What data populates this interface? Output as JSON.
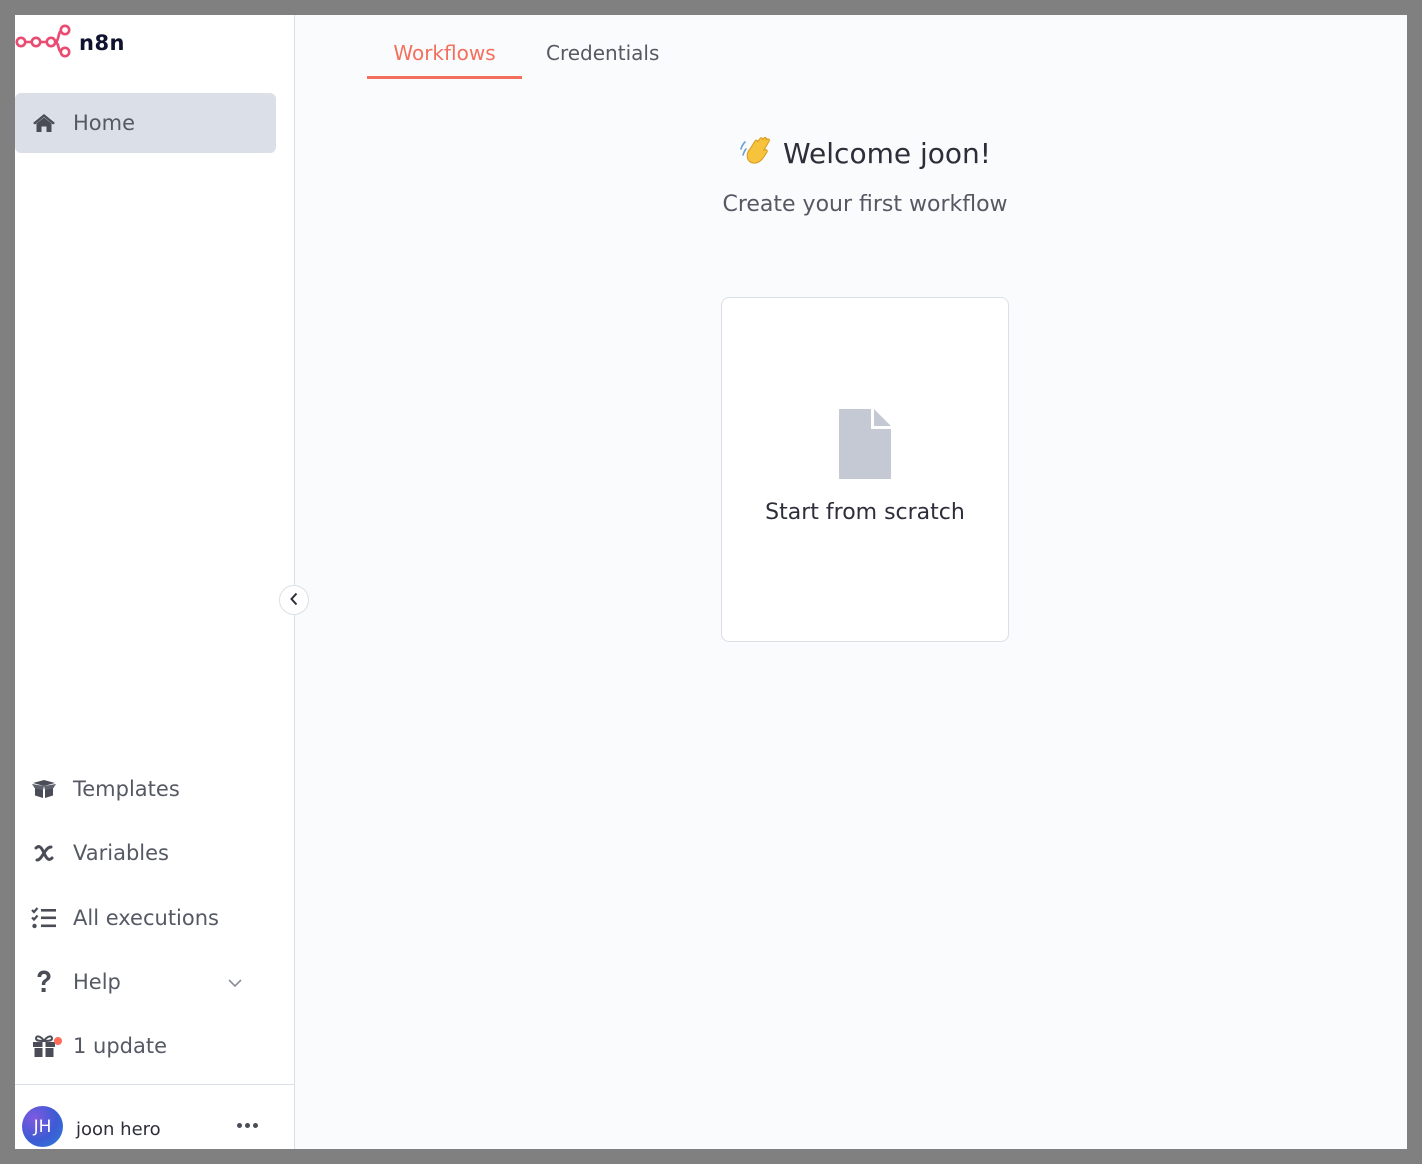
{
  "brand": {
    "name": "n8n",
    "accent": "#ea4b71"
  },
  "sidebar": {
    "home": {
      "label": "Home",
      "icon": "home-icon"
    },
    "bottom_items": [
      {
        "label": "Templates",
        "icon": "box-open-icon"
      },
      {
        "label": "Variables",
        "icon": "variable-x-icon"
      },
      {
        "label": "All executions",
        "icon": "tasks-list-icon"
      },
      {
        "label": "Help",
        "icon": "question-icon"
      },
      {
        "label": "1 update",
        "icon": "gift-icon"
      }
    ],
    "user": {
      "initials": "JH",
      "name": "joon hero"
    }
  },
  "tabs": [
    {
      "label": "Workflows",
      "active": true
    },
    {
      "label": "Credentials",
      "active": false
    }
  ],
  "main": {
    "welcome_title": "Welcome joon!",
    "welcome_emoji": "wave-icon",
    "subtitle": "Create your first workflow",
    "scratch_card_label": "Start from scratch"
  },
  "colors": {
    "active_tab": "#f2705d",
    "update_dot": "#ff6d5a",
    "nav_active_bg": "#dbdfe7"
  }
}
